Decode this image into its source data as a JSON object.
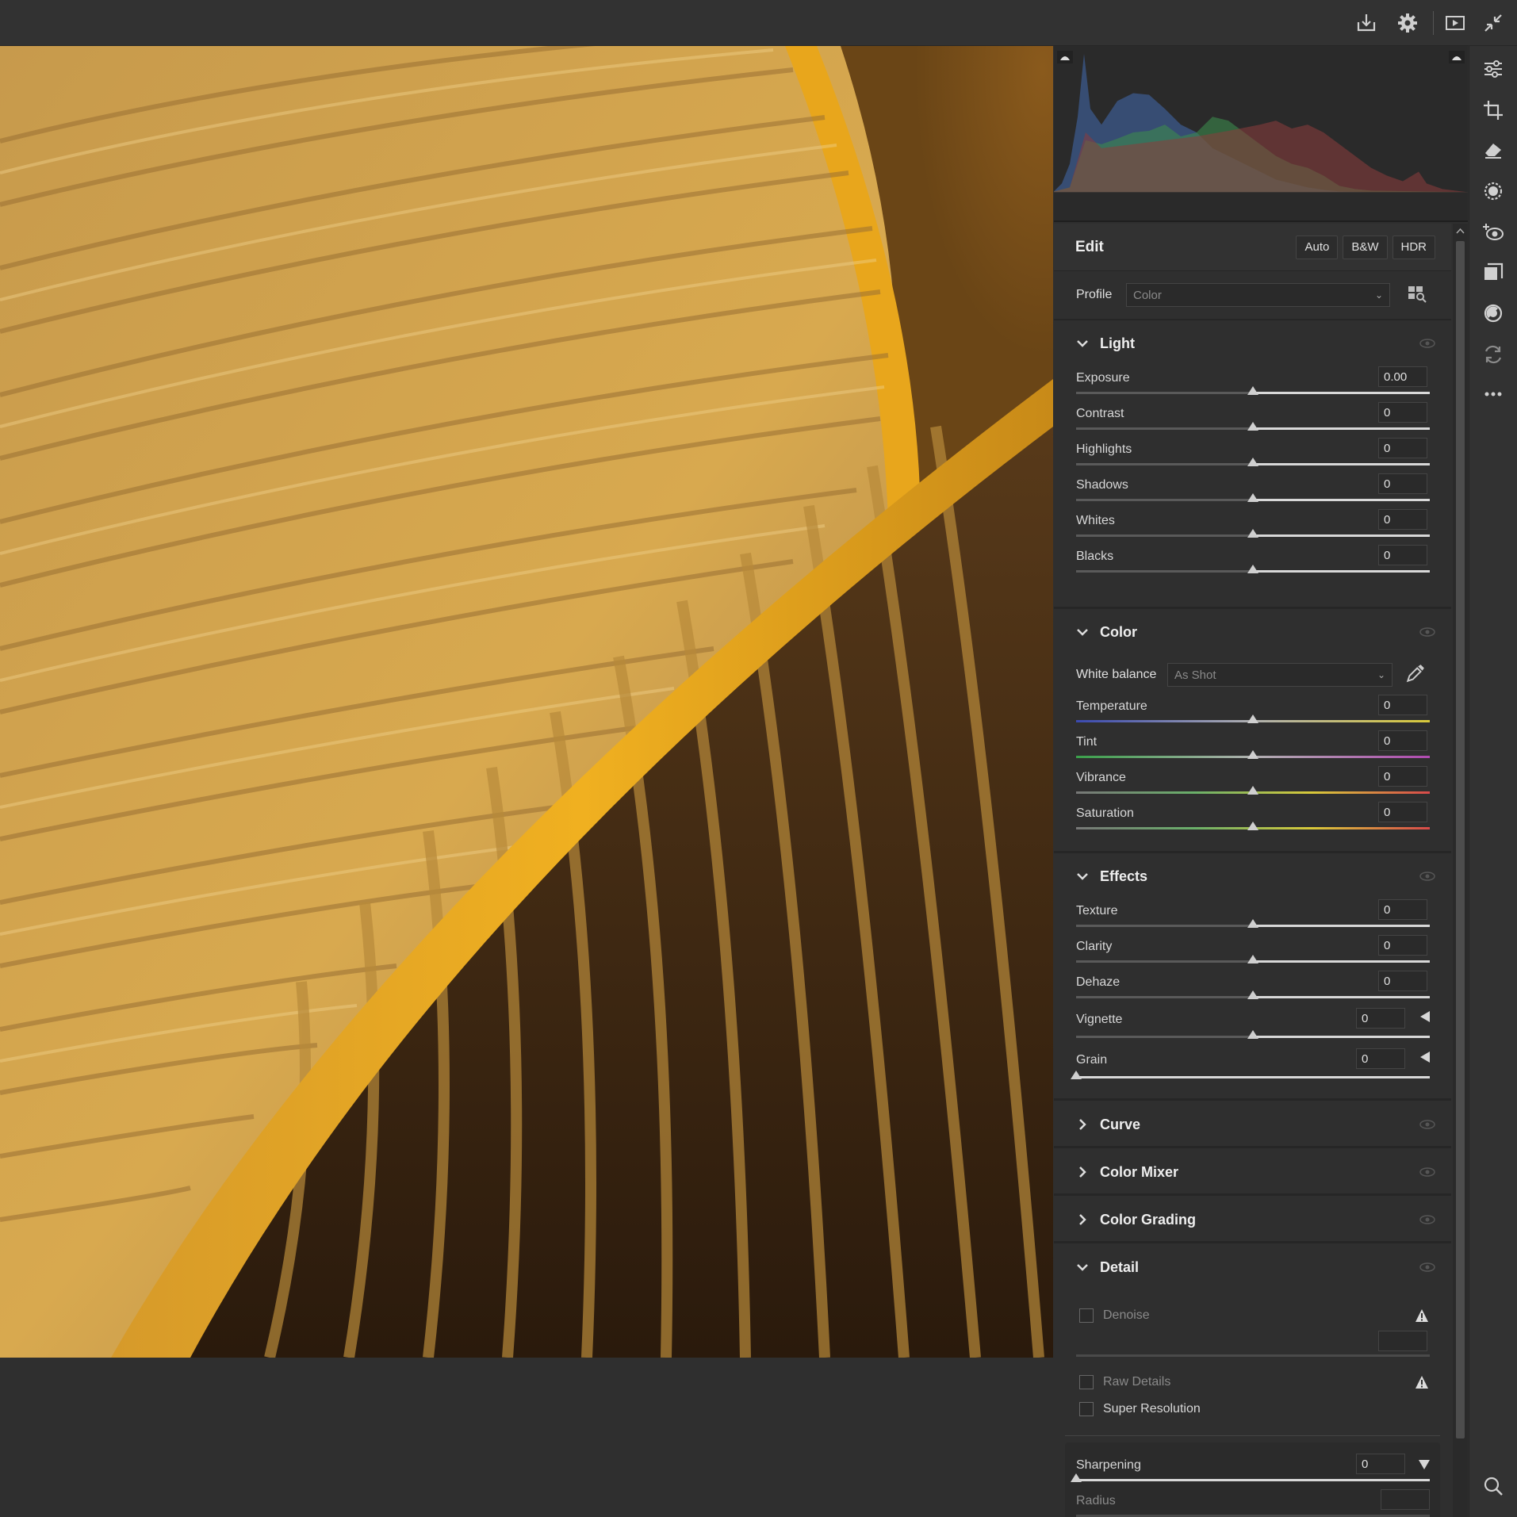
{
  "colors": {
    "accent": "#cfcfcf",
    "panel_bg": "#2f2f2f",
    "topbar_bg": "#323232"
  },
  "topbar": {
    "icons": [
      "export-icon",
      "gear-icon",
      "slideshow-icon",
      "exit-fullscreen-icon"
    ]
  },
  "edit": {
    "title": "Edit",
    "buttons": {
      "auto": "Auto",
      "bw": "B&W",
      "hdr": "HDR"
    }
  },
  "profile": {
    "label": "Profile",
    "value": "Color"
  },
  "light": {
    "title": "Light",
    "sliders": [
      {
        "label": "Exposure",
        "value": "0.00"
      },
      {
        "label": "Contrast",
        "value": "0"
      },
      {
        "label": "Highlights",
        "value": "0"
      },
      {
        "label": "Shadows",
        "value": "0"
      },
      {
        "label": "Whites",
        "value": "0"
      },
      {
        "label": "Blacks",
        "value": "0"
      }
    ]
  },
  "color": {
    "title": "Color",
    "white_balance_label": "White balance",
    "white_balance_value": "As Shot",
    "sliders": [
      {
        "label": "Temperature",
        "value": "0"
      },
      {
        "label": "Tint",
        "value": "0"
      },
      {
        "label": "Vibrance",
        "value": "0"
      },
      {
        "label": "Saturation",
        "value": "0"
      }
    ]
  },
  "effects": {
    "title": "Effects",
    "sliders": [
      {
        "label": "Texture",
        "value": "0"
      },
      {
        "label": "Clarity",
        "value": "0"
      },
      {
        "label": "Dehaze",
        "value": "0"
      },
      {
        "label": "Vignette",
        "value": "0"
      },
      {
        "label": "Grain",
        "value": "0"
      }
    ]
  },
  "collapsed_sections": [
    {
      "title": "Curve"
    },
    {
      "title": "Color Mixer"
    },
    {
      "title": "Color Grading"
    }
  ],
  "detail": {
    "title": "Detail",
    "denoise": "Denoise",
    "raw_details": "Raw Details",
    "super_resolution": "Super Resolution",
    "sharpening": {
      "label": "Sharpening",
      "value": "0"
    },
    "radius": {
      "label": "Radius"
    }
  },
  "toolstrip": {
    "icons": [
      "edit-sliders-icon",
      "crop-icon",
      "healing-eraser-icon",
      "masking-icon",
      "red-eye-icon",
      "presets-icon",
      "snapshots-icon",
      "versions-icon",
      "more-icon",
      "zoom-icon"
    ]
  }
}
